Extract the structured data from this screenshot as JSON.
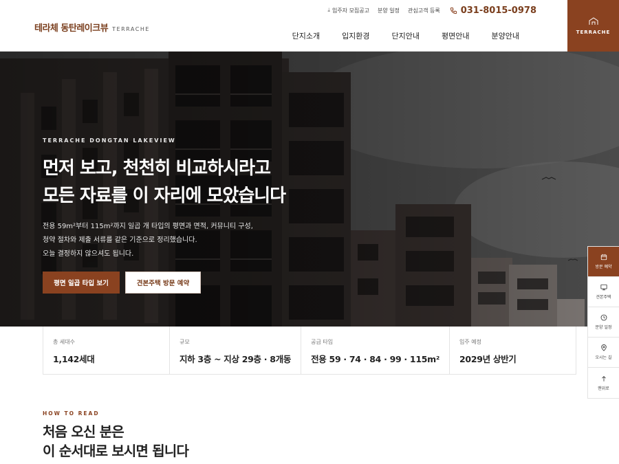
{
  "brand": {
    "name_ko": "테라체 동탄레이크뷰",
    "name_en": "TERRACHE",
    "box_label": "TERRACHE"
  },
  "utility": {
    "items": [
      {
        "icon": "download-icon",
        "label": "입주자 모집공고"
      },
      {
        "label": "분양 일정"
      },
      {
        "label": "관심고객 등록"
      }
    ],
    "phone": "031-8015-0978"
  },
  "nav": {
    "items": [
      "단지소개",
      "입지환경",
      "단지안내",
      "평면안내",
      "분양안내"
    ]
  },
  "hero": {
    "eyebrow": "TERRACHE DONGTAN LAKEVIEW",
    "title_line1": "먼저 보고, 천천히 비교하시라고",
    "title_line2": "모든 자료를 이 자리에 모았습니다",
    "desc_line1": "전용 59m²부터 115m²까지 일곱 개 타입의 평면과 면적, 커뮤니티 구성,",
    "desc_line2": "청약 절차와 제출 서류를 같은 기준으로 정리했습니다.",
    "desc_line3": "오늘 결정하지 않으셔도 됩니다.",
    "btn_primary": "평면 일곱 타입 보기",
    "btn_secondary": "견본주택 방문 예약"
  },
  "stats": [
    {
      "label": "총 세대수",
      "value": "1,142세대"
    },
    {
      "label": "규모",
      "value": "지하 3층 ~ 지상 29층 · 8개동"
    },
    {
      "label": "공급 타입",
      "value": "전용 59 · 74 · 84 · 99 · 115m²"
    },
    {
      "label": "입주 예정",
      "value": "2029년 상반기"
    }
  ],
  "section": {
    "eyebrow": "HOW TO READ",
    "title_line1": "처음 오신 분은",
    "title_line2": "이 순서대로 보시면 됩니다"
  },
  "quick_menu": [
    {
      "icon": "calendar-icon",
      "label": "방문 예약"
    },
    {
      "icon": "monitor-icon",
      "label": "견본주택"
    },
    {
      "icon": "clock-icon",
      "label": "분양 일정"
    },
    {
      "icon": "map-pin-icon",
      "label": "오시는 길"
    },
    {
      "icon": "arrow-up-icon",
      "label": "맨위로"
    }
  ],
  "colors": {
    "accent": "#8a4220",
    "accent_dark": "#7a3e1d",
    "text": "#222222"
  }
}
